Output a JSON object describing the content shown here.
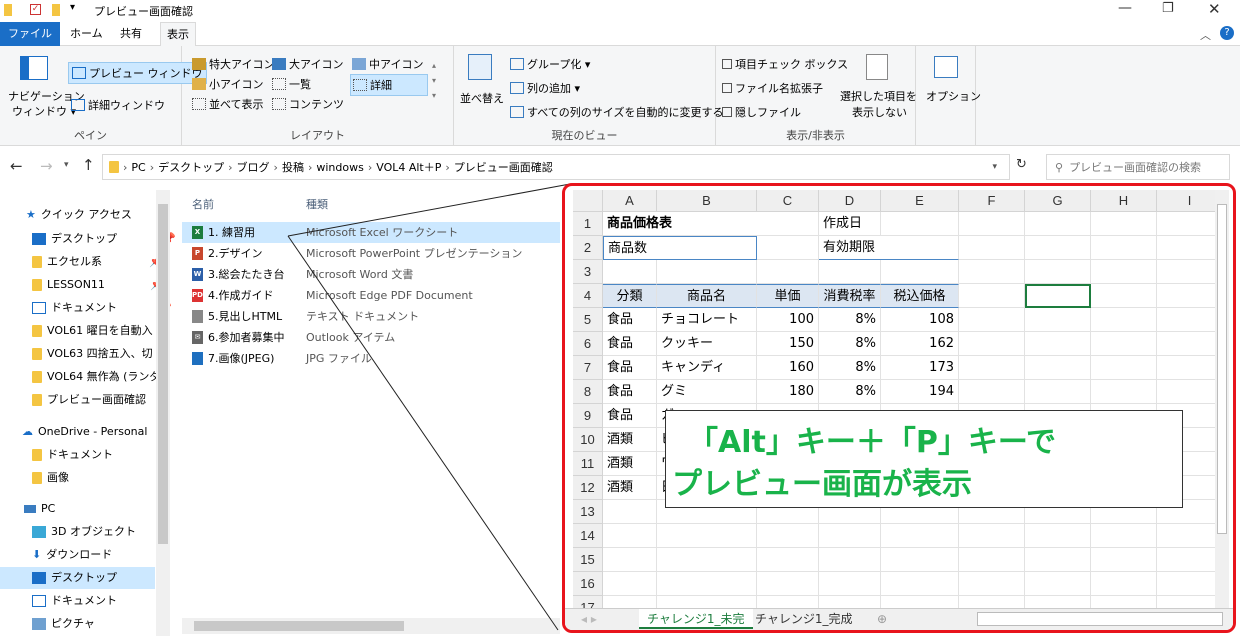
{
  "window": {
    "title": "プレビュー画面確認"
  },
  "tabs": {
    "file": "ファイル",
    "home": "ホーム",
    "share": "共有",
    "view": "表示"
  },
  "ribbon": {
    "pane": {
      "nav": "ナビゲーション",
      "nav2": "ウィンドウ ▾",
      "preview": "プレビュー ウィンドウ",
      "details": "詳細ウィンドウ",
      "label": "ペイン"
    },
    "layout": {
      "xl": "特大アイコン",
      "large": "大アイコン",
      "medium": "中アイコン",
      "small": "小アイコン",
      "list": "一覧",
      "details": "詳細",
      "tiles": "並べて表示",
      "content": "コンテンツ",
      "label": "レイアウト"
    },
    "view": {
      "sort": "並べ替え",
      "group": "グループ化 ▾",
      "addcol": "列の追加 ▾",
      "fit": "すべての列のサイズを自動的に変更する",
      "label": "現在のビュー"
    },
    "show": {
      "check": "項目チェック ボックス",
      "ext": "ファイル名拡張子",
      "hidden": "隠しファイル",
      "hide_sel": "選択した項目を",
      "hide_sel2": "表示しない",
      "label": "表示/非表示"
    },
    "options": "オプション"
  },
  "address": {
    "parts": [
      "PC",
      "デスクトップ",
      "ブログ",
      "投稿",
      "windows",
      "VOL4 Alt＋P",
      "プレビュー画面確認"
    ],
    "search_placeholder": "プレビュー画面確認の検索"
  },
  "nav": {
    "quick": "クイック アクセス",
    "items": [
      "デスクトップ",
      "エクセル系",
      "LESSON11",
      "ドキュメント",
      "VOL61 曜日を自動入",
      "VOL63 四捨五入、切",
      "VOL64 無作為 (ランダ",
      "プレビュー画面確認"
    ],
    "onedrive": "OneDrive - Personal",
    "od_items": [
      "ドキュメント",
      "画像"
    ],
    "pc": "PC",
    "pc_items": [
      "3D オブジェクト",
      "ダウンロード",
      "デスクトップ",
      "ドキュメント",
      "ピクチャ"
    ]
  },
  "files": {
    "col_name": "名前",
    "col_type": "種類",
    "rows": [
      {
        "name": "1. 練習用",
        "type": "Microsoft Excel ワークシート",
        "icon": "excel-icon",
        "color": "#1d7d3e",
        "glyph": "X"
      },
      {
        "name": "2.デザイン",
        "type": "Microsoft PowerPoint プレゼンテーション",
        "icon": "powerpoint-icon",
        "color": "#c8472d",
        "glyph": "P"
      },
      {
        "name": "3.総会たたき台",
        "type": "Microsoft Word 文書",
        "icon": "word-icon",
        "color": "#2b5ea8",
        "glyph": "W"
      },
      {
        "name": "4.作成ガイド",
        "type": "Microsoft Edge PDF Document",
        "icon": "pdf-icon",
        "color": "#d33",
        "glyph": "PDF"
      },
      {
        "name": "5.見出しHTML",
        "type": "テキスト ドキュメント",
        "icon": "text-file-icon",
        "color": "#888",
        "glyph": ""
      },
      {
        "name": "6.参加者募集中",
        "type": "Outlook アイテム",
        "icon": "mail-icon",
        "color": "#666",
        "glyph": "✉"
      },
      {
        "name": "7.画像(JPEG)",
        "type": "JPG ファイル",
        "icon": "image-file-icon",
        "color": "#1e6fbf",
        "glyph": ""
      }
    ]
  },
  "sheet": {
    "cols": [
      "A",
      "B",
      "C",
      "D",
      "E",
      "F",
      "G",
      "H",
      "I"
    ],
    "rows": [
      "1",
      "2",
      "3",
      "4",
      "5",
      "6",
      "7",
      "8",
      "9",
      "10",
      "11",
      "12",
      "13",
      "14",
      "15",
      "16",
      "17"
    ],
    "title": "商品価格表",
    "date_label": "作成日",
    "product_count": "商品数",
    "expiry": "有効期限",
    "headers": [
      "分類",
      "商品名",
      "単価",
      "消費税率",
      "税込価格"
    ],
    "data": [
      [
        "食品",
        "チョコレート",
        "100",
        "8%",
        "108"
      ],
      [
        "食品",
        "クッキー",
        "150",
        "8%",
        "162"
      ],
      [
        "食品",
        "キャンディ",
        "160",
        "8%",
        "173"
      ],
      [
        "食品",
        "グミ",
        "180",
        "8%",
        "194"
      ],
      [
        "食品",
        "ガ",
        "",
        "",
        ""
      ],
      [
        "酒類",
        "ビ",
        "",
        "",
        ""
      ],
      [
        "酒類",
        "ワ",
        "",
        "",
        ""
      ],
      [
        "酒類",
        "日",
        "",
        "",
        ""
      ]
    ],
    "tabs": [
      "チャレンジ1_未完",
      "チャレンジ1_完成"
    ]
  },
  "callout": {
    "line1": "「Alt」キー＋「P」キーで",
    "line2": "プレビュー画面が表示"
  }
}
